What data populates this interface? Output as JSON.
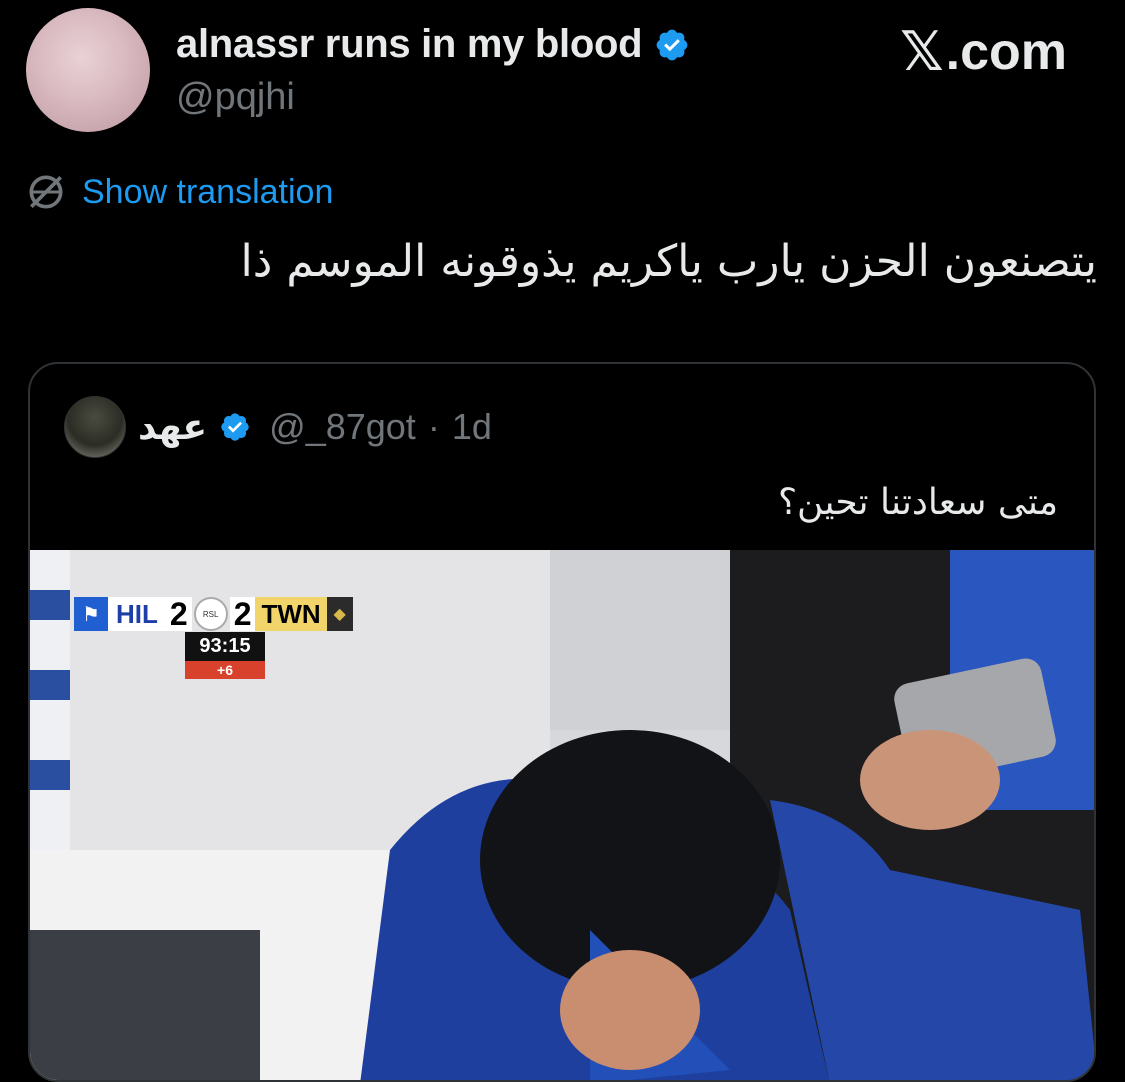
{
  "author": {
    "display_name": "alnassr runs in my blood",
    "handle": "@pqjhi"
  },
  "brand": {
    "site": ".com",
    "x_mark": "𝕏"
  },
  "translation": {
    "label": "Show translation"
  },
  "tweet": {
    "text": "يتصنعون الحزن يارب ياكريم يذوقونه الموسم ذا"
  },
  "quoted_tweet": {
    "display_name": "عهد",
    "handle": "@_87got",
    "separator": "·",
    "time": "1d",
    "text": "متى سعادتنا تحين؟"
  },
  "scoreboard": {
    "home_team": "HIL",
    "home_score": "2",
    "away_score": "2",
    "away_team": "TWN",
    "league_badge": "RSL",
    "clock": "93:15",
    "added_time": "+6"
  },
  "colors": {
    "background": "#000000",
    "text": "#e7e9ea",
    "muted": "#71767b",
    "link": "#1d9bf0",
    "verified": "#1d9bf0",
    "border": "#2f3336"
  },
  "icons": {
    "verified": "verified-badge-icon",
    "translate": "globe-slash-icon"
  }
}
